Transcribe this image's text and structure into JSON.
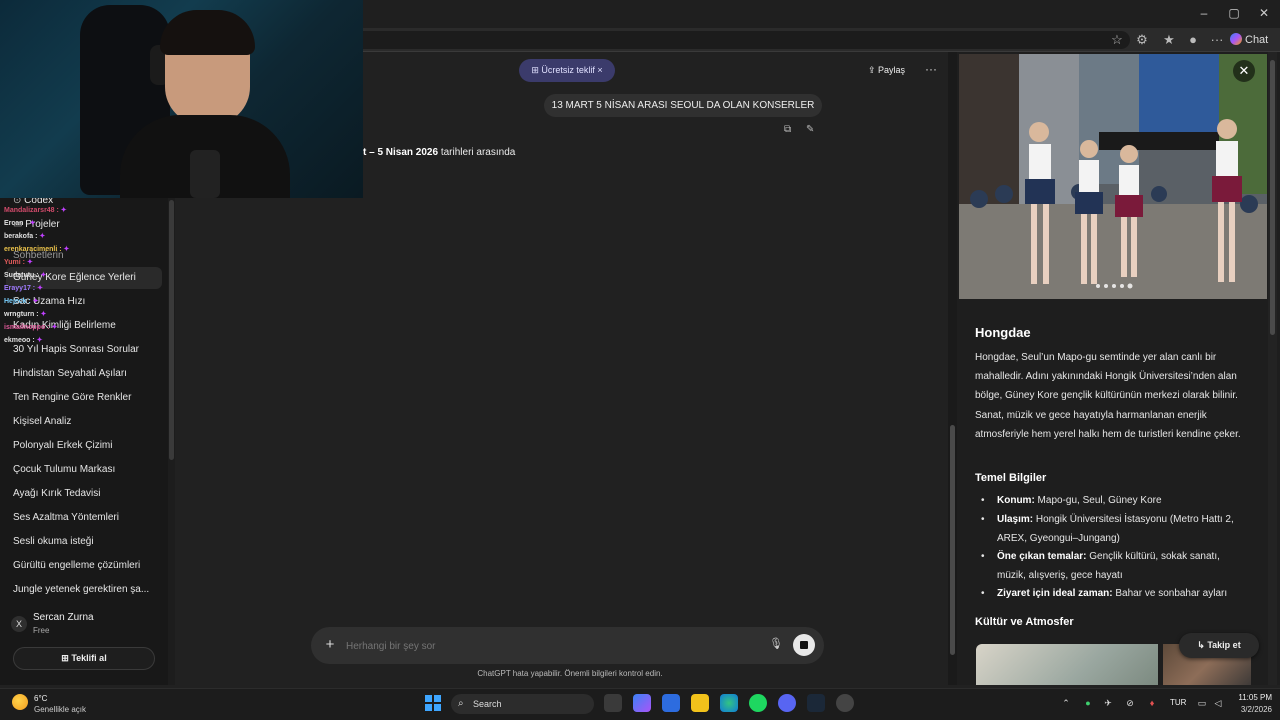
{
  "window": {
    "minimize": "–",
    "maximize": "▢",
    "close": "✕"
  },
  "browser": {
    "chat_label": "Chat",
    "more_glyph": "···"
  },
  "stream_chat": [
    {
      "user": "Mandalizarsr48 :",
      "color": "#d24b6b"
    },
    {
      "user": "Ercan :",
      "color": "#e0e0e0"
    },
    {
      "user": "berakofa :",
      "color": "#e0e0e0"
    },
    {
      "user": "erenkaracimenli :",
      "color": "#e8c04a"
    },
    {
      "user": "Yumi :",
      "color": "#e05a5a"
    },
    {
      "user": "Sudatutu :",
      "color": "#e0e0e0"
    },
    {
      "user": "Erayy17 :",
      "color": "#a07aff"
    },
    {
      "user": "Hejeck :",
      "color": "#7ad0ff"
    },
    {
      "user": "wrngturn :",
      "color": "#e0e0e0"
    },
    {
      "user": "ismailnoppo :",
      "color": "#e05a9a"
    },
    {
      "user": "ekmeoo :",
      "color": "#e0e0e0"
    }
  ],
  "sidebar": {
    "codex": "Codex",
    "projects": "Projeler",
    "chats_header": "Sohbetlerin",
    "items": [
      {
        "label": "Güney Kore Eğlence Yerleri",
        "active": true
      },
      {
        "label": "Sac Uzama Hızı"
      },
      {
        "label": "Kadın Kimliği Belirleme"
      },
      {
        "label": "30 Yıl Hapis Sonrası Sorular"
      },
      {
        "label": "Hindistan Seyahati Aşıları"
      },
      {
        "label": "Ten Rengine Göre Renkler"
      },
      {
        "label": "Kişisel Analiz"
      },
      {
        "label": "Polonyalı Erkek Çizimi"
      },
      {
        "label": "Çocuk Tulumu Markası"
      },
      {
        "label": "Ayağı Kırık Tedavisi"
      },
      {
        "label": "Ses Azaltma Yöntemleri"
      },
      {
        "label": "Sesli okuma isteği"
      },
      {
        "label": "Gürültü engelleme çözümleri"
      },
      {
        "label": "Jungle yetenek gerektiren şa..."
      }
    ],
    "user": {
      "initials": "X",
      "name": "Sercan Zurna",
      "plan": "Free"
    },
    "offer_button": "Teklifi al"
  },
  "header": {
    "free_offer": "Ücretsiz teklif",
    "free_offer_close": "×",
    "share": "Paylaş",
    "more": "···"
  },
  "conversation": {
    "user_message": "13 MART 5 NİSAN ARASI SEOUL DA OLAN KONSERLER",
    "assistant_partial": "t – ",
    "assistant_bold": "5 Nisan 2026",
    "assistant_rest": " tarihleri arasında"
  },
  "composer": {
    "plus": "+",
    "placeholder": "Herhangi bir şey sor",
    "mic": "🎙",
    "disclaimer": "ChatGPT hata yapabilir. Önemli bilgileri kontrol edin."
  },
  "panel": {
    "close": "✕",
    "title": "Hongdae",
    "description": "Hongdae, Seul’un Mapo-gu semtinde yer alan canlı bir mahalledir. Adını yakınındaki Hongik Üniversitesi’nden alan bölge, Güney Kore gençlik kültürünün merkezi olarak bilinir. Sanat, müzik ve gece hayatıyla harmanlanan enerjik atmosferiyle hem yerel halkı hem de turistleri kendine çeker.",
    "basics_title": "Temel Bilgiler",
    "basics": [
      {
        "key": "Konum:",
        "value": " Mapo-gu, Seul, Güney Kore"
      },
      {
        "key": "Ulaşım:",
        "value": " Hongik Üniversitesi İstasyonu (Metro Hattı 2, AREX, Gyeongui–Jungang)"
      },
      {
        "key": "Öne çıkan temalar:",
        "value": " Gençlik kültürü, sokak sanatı, müzik, alışveriş, gece hayatı"
      },
      {
        "key": "Ziyaret için ideal zaman:",
        "value": " Bahar ve sonbahar ayları"
      }
    ],
    "culture_title": "Kültür ve Atmosfer",
    "follow": "Takip et"
  },
  "taskbar": {
    "temp": "6°C",
    "weather": "Genellikle açık",
    "search": "Search",
    "lang": "TUR",
    "time": "11:05 PM",
    "date": "3/2/2026"
  },
  "colors": {
    "accent": "#3b3b6b",
    "background": "#212121",
    "sidebar": "#181818"
  }
}
